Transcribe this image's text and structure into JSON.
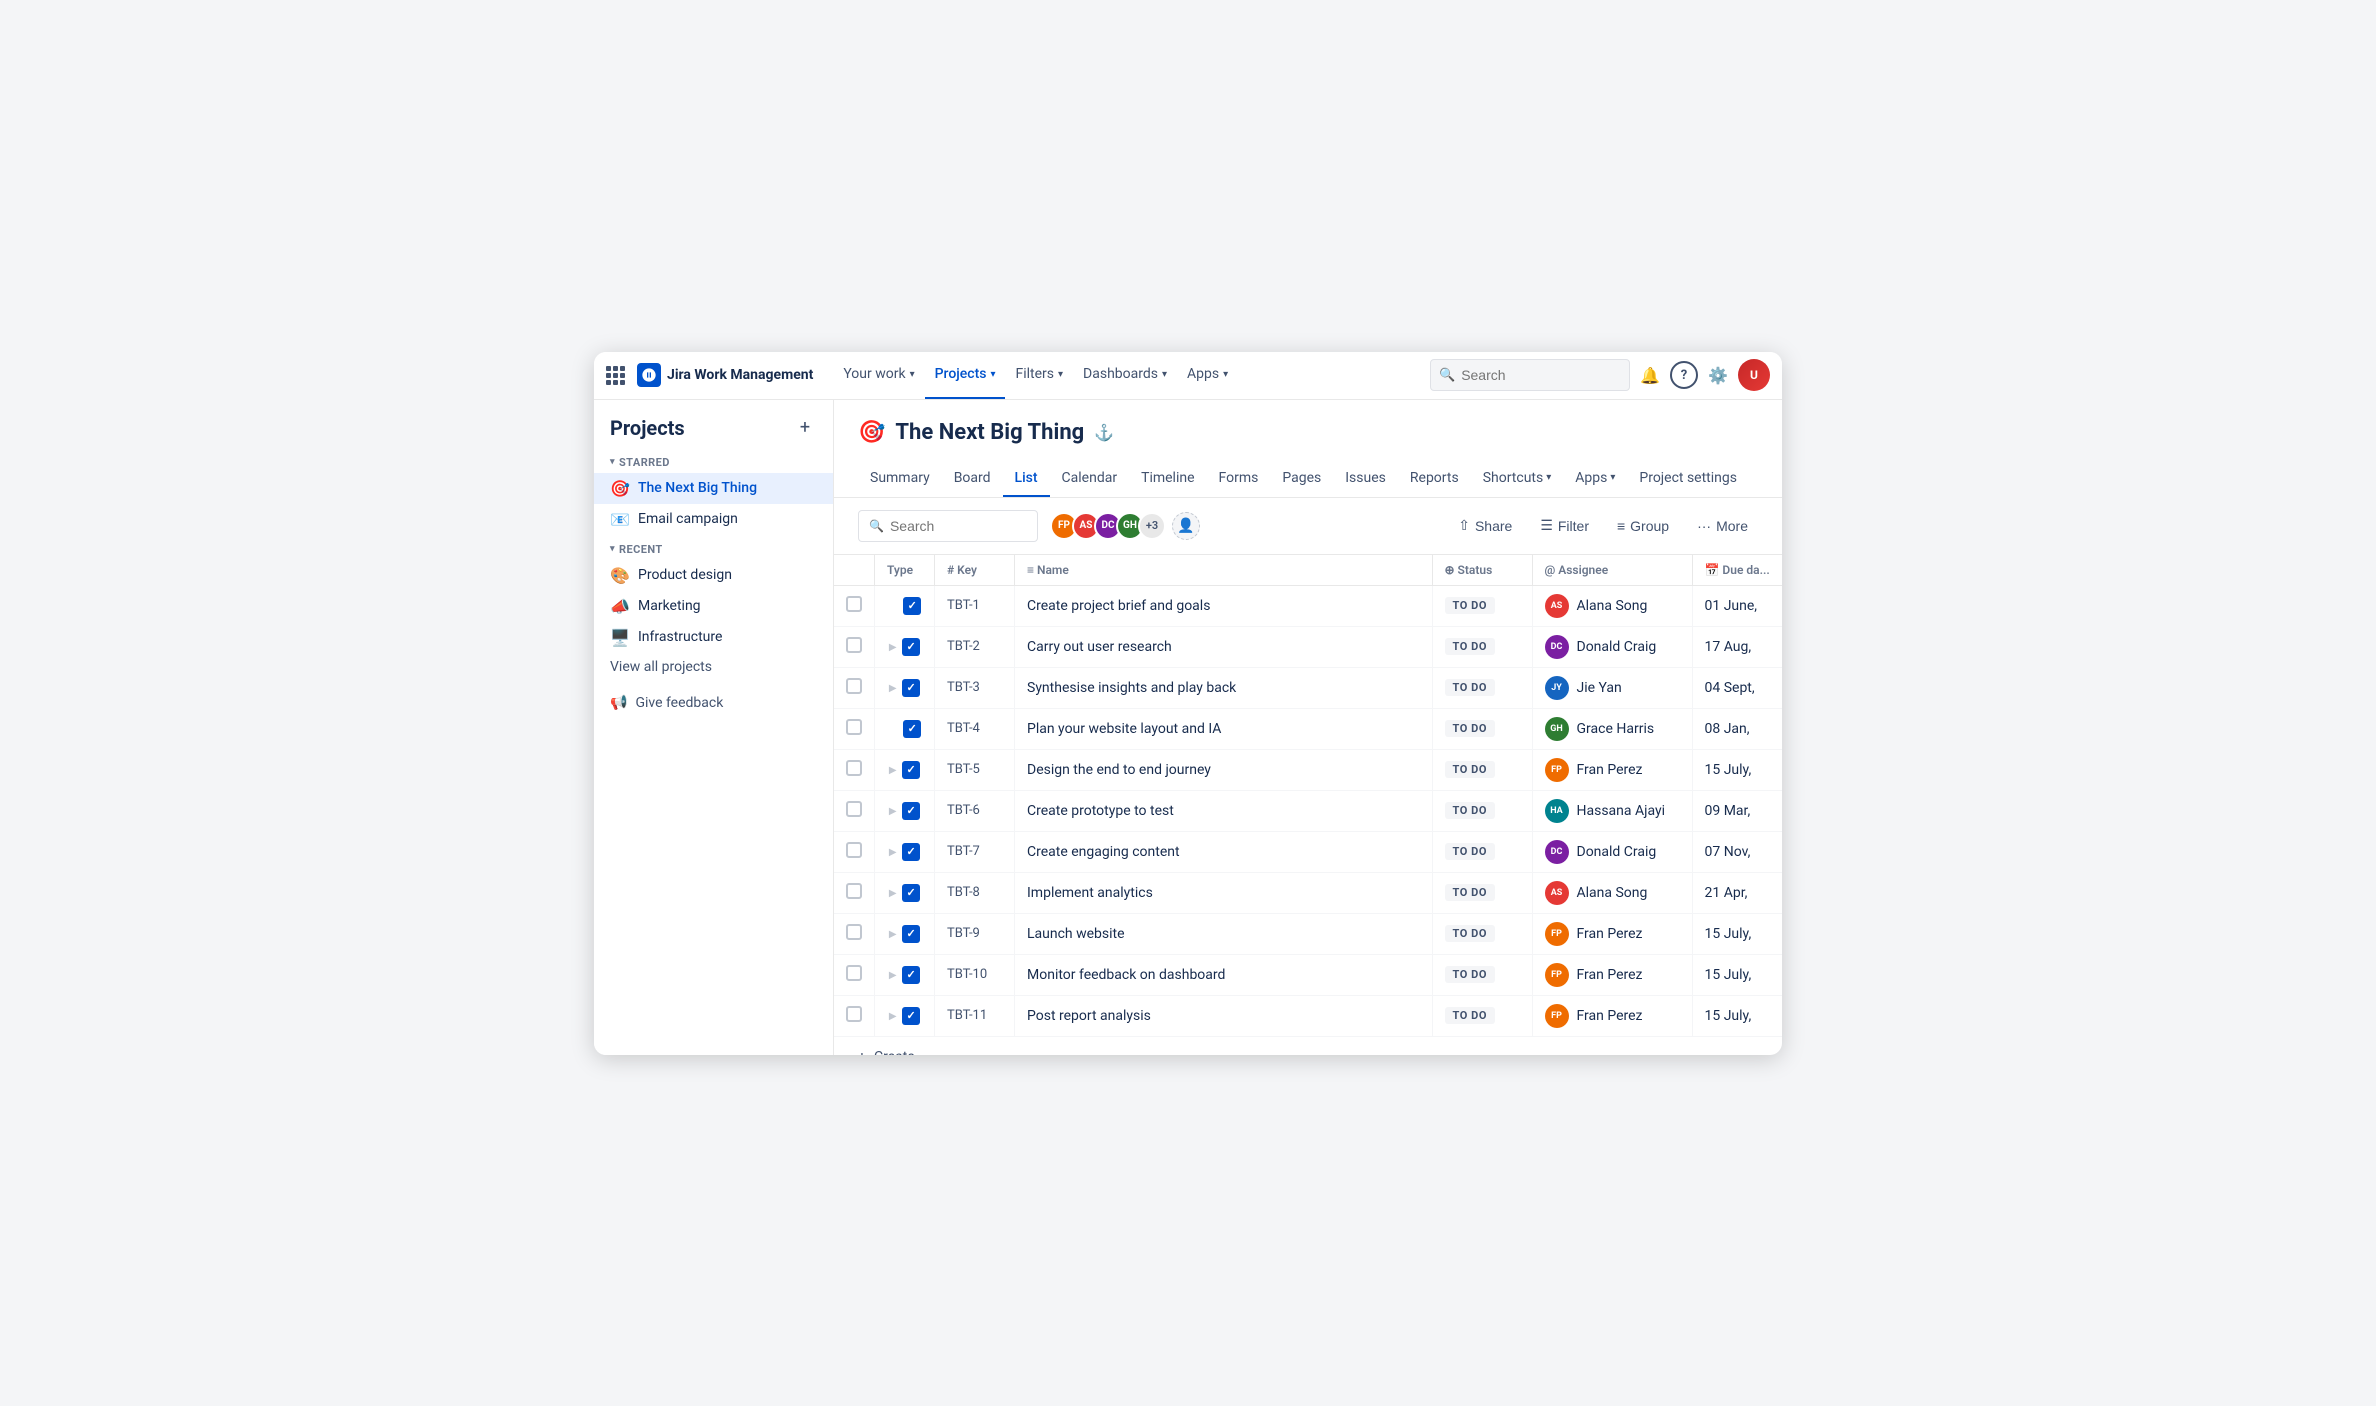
{
  "app": {
    "name": "Jira Work Management"
  },
  "topnav": {
    "items": [
      {
        "label": "Your work",
        "dropdown": true,
        "active": false
      },
      {
        "label": "Projects",
        "dropdown": true,
        "active": true
      },
      {
        "label": "Filters",
        "dropdown": true,
        "active": false
      },
      {
        "label": "Dashboards",
        "dropdown": true,
        "active": false
      },
      {
        "label": "Apps",
        "dropdown": true,
        "active": false
      }
    ],
    "search_placeholder": "Search"
  },
  "sidebar": {
    "title": "Projects",
    "groups": [
      {
        "label": "STARRED",
        "items": [
          {
            "emoji": "🎯",
            "name": "The Next Big Thing",
            "active": true
          },
          {
            "emoji": "📧",
            "name": "Email campaign",
            "active": false
          }
        ]
      },
      {
        "label": "RECENT",
        "items": [
          {
            "emoji": "🎨",
            "name": "Product design",
            "active": false
          },
          {
            "emoji": "📣",
            "name": "Marketing",
            "active": false
          },
          {
            "emoji": "🖥️",
            "name": "Infrastructure",
            "active": false
          }
        ]
      }
    ],
    "view_all": "View all projects",
    "feedback": "Give feedback"
  },
  "project": {
    "emoji": "🎯",
    "name": "The Next Big Thing",
    "tabs": [
      "Summary",
      "Board",
      "List",
      "Calendar",
      "Timeline",
      "Forms",
      "Pages",
      "Issues",
      "Reports",
      "Shortcuts",
      "Apps",
      "Project settings"
    ],
    "active_tab": "List"
  },
  "toolbar": {
    "search_placeholder": "Search",
    "avatar_count": "+3",
    "share_label": "Share",
    "filter_label": "Filter",
    "group_label": "Group",
    "more_label": "More"
  },
  "table": {
    "columns": [
      "",
      "Type",
      "Key",
      "Name",
      "Status",
      "Assignee",
      "Due da..."
    ],
    "rows": [
      {
        "key": "TBT-1",
        "name": "Create project brief and goals",
        "status": "TO DO",
        "assignee": "Alana Song",
        "assignee_initials": "AS",
        "assignee_color": "av-alana",
        "due": "01 June,",
        "has_expand": false
      },
      {
        "key": "TBT-2",
        "name": "Carry out user research",
        "status": "TO DO",
        "assignee": "Donald Craig",
        "assignee_initials": "DC",
        "assignee_color": "av-donald",
        "due": "17 Aug,",
        "has_expand": true
      },
      {
        "key": "TBT-3",
        "name": "Synthesise insights and play back",
        "status": "TO DO",
        "assignee": "Jie Yan",
        "assignee_initials": "JY",
        "assignee_color": "av-jie",
        "due": "04 Sept,",
        "has_expand": true
      },
      {
        "key": "TBT-4",
        "name": "Plan your website layout and IA",
        "status": "TO DO",
        "assignee": "Grace Harris",
        "assignee_initials": "GH",
        "assignee_color": "av-grace",
        "due": "08 Jan,",
        "has_expand": false
      },
      {
        "key": "TBT-5",
        "name": "Design the end to end journey",
        "status": "TO DO",
        "assignee": "Fran Perez",
        "assignee_initials": "FP",
        "assignee_color": "av-fran",
        "due": "15 July,",
        "has_expand": true
      },
      {
        "key": "TBT-6",
        "name": "Create prototype to test",
        "status": "TO DO",
        "assignee": "Hassana Ajayi",
        "assignee_initials": "HA",
        "assignee_color": "av-hassana",
        "due": "09 Mar,",
        "has_expand": true
      },
      {
        "key": "TBT-7",
        "name": "Create engaging content",
        "status": "TO DO",
        "assignee": "Donald Craig",
        "assignee_initials": "DC",
        "assignee_color": "av-donald",
        "due": "07 Nov,",
        "has_expand": true
      },
      {
        "key": "TBT-8",
        "name": "Implement analytics",
        "status": "TO DO",
        "assignee": "Alana Song",
        "assignee_initials": "AS",
        "assignee_color": "av-alana",
        "due": "21 Apr,",
        "has_expand": true
      },
      {
        "key": "TBT-9",
        "name": "Launch website",
        "status": "TO DO",
        "assignee": "Fran Perez",
        "assignee_initials": "FP",
        "assignee_color": "av-fran",
        "due": "15 July,",
        "has_expand": true
      },
      {
        "key": "TBT-10",
        "name": "Monitor feedback on dashboard",
        "status": "TO DO",
        "assignee": "Fran Perez",
        "assignee_initials": "FP",
        "assignee_color": "av-fran",
        "due": "15 July,",
        "has_expand": true
      },
      {
        "key": "TBT-11",
        "name": "Post report analysis",
        "status": "TO DO",
        "assignee": "Fran Perez",
        "assignee_initials": "FP",
        "assignee_color": "av-fran",
        "due": "15 July,",
        "has_expand": true
      }
    ],
    "create_label": "Create"
  },
  "avatars": [
    {
      "initials": "FP",
      "color": "#ef6c00"
    },
    {
      "initials": "AS",
      "color": "#e53935"
    },
    {
      "initials": "DC",
      "color": "#7b1fa2"
    },
    {
      "initials": "GH",
      "color": "#2e7d32"
    }
  ]
}
